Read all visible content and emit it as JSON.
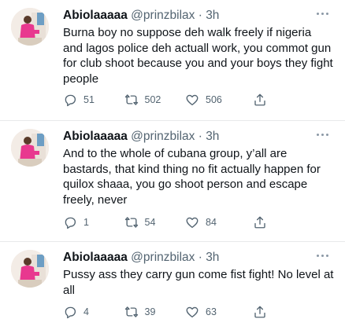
{
  "tweets": [
    {
      "name": "Abiolaaaaa",
      "handle": "@prinzbilax",
      "dot": "·",
      "time": "3h",
      "text": "Burna boy no suppose deh walk freely if nigeria and lagos police deh actuall work, you commot gun for club shoot because you and your boys they fight people",
      "replies": "51",
      "retweets": "502",
      "likes": "506"
    },
    {
      "name": "Abiolaaaaa",
      "handle": "@prinzbilax",
      "dot": "·",
      "time": "3h",
      "text": "And to the whole of cubana group, y’all are bastards, that kind thing no fit actually happen for quilox shaaa, you go shoot person and escape freely, never",
      "replies": "1",
      "retweets": "54",
      "likes": "84"
    },
    {
      "name": "Abiolaaaaa",
      "handle": "@prinzbilax",
      "dot": "·",
      "time": "3h",
      "text": "Pussy ass they carry gun come fist fight! No level at all",
      "replies": "4",
      "retweets": "39",
      "likes": "63"
    }
  ],
  "icons": {
    "reply": "reply-icon",
    "retweet": "retweet-icon",
    "like": "like-icon",
    "share": "share-icon",
    "more": "more-icon"
  },
  "colors": {
    "text": "#0f1419",
    "muted": "#536471",
    "avatar_accent": "#e8388f"
  }
}
